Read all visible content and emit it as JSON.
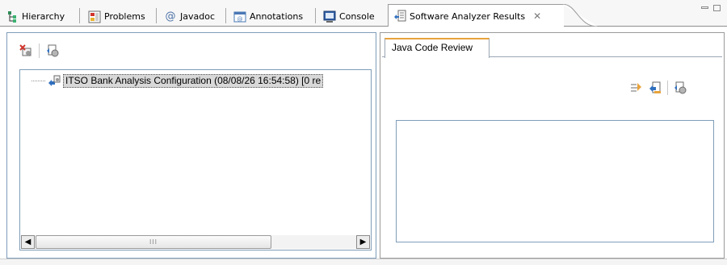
{
  "tabs": [
    {
      "label": "Hierarchy",
      "icon": "hierarchy-icon"
    },
    {
      "label": "Problems",
      "icon": "problems-icon"
    },
    {
      "label": "Javadoc",
      "icon": "javadoc-icon"
    },
    {
      "label": "Annotations",
      "icon": "annotations-icon"
    },
    {
      "label": "Console",
      "icon": "console-icon"
    },
    {
      "label": "Software Analyzer Results",
      "icon": "software-analyzer-icon",
      "active": true
    }
  ],
  "left_panel": {
    "tree_items": [
      {
        "label": "ITSO Bank Analysis Configuration (08/08/26 16:54:58)  [0 re"
      }
    ],
    "scroll_grip": "III"
  },
  "right_panel": {
    "tab_label": "Java Code Review"
  },
  "colors": {
    "active_tab_accent": "#e8a33c",
    "border_blue": "#7f9db9",
    "selection_bg": "#d8d8d8"
  }
}
